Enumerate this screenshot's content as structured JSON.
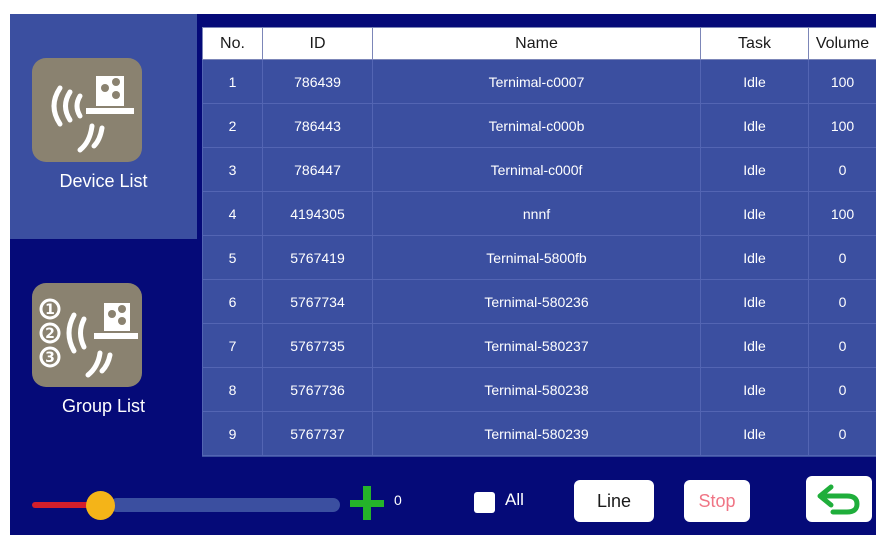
{
  "sidebar": {
    "device_list_label": "Device List",
    "group_list_label": "Group List"
  },
  "table": {
    "headers": [
      "No.",
      "ID",
      "Name",
      "Task",
      "Volume"
    ],
    "rows": [
      [
        "1",
        "786439",
        "Ternimal-c0007",
        "Idle",
        "100"
      ],
      [
        "2",
        "786443",
        "Ternimal-c000b",
        "Idle",
        "100"
      ],
      [
        "3",
        "786447",
        "Ternimal-c000f",
        "Idle",
        "0"
      ],
      [
        "4",
        "4194305",
        "nnnf",
        "Idle",
        "100"
      ],
      [
        "5",
        "5767419",
        "Ternimal-5800fb",
        "Idle",
        "0"
      ],
      [
        "6",
        "5767734",
        "Ternimal-580236",
        "Idle",
        "0"
      ],
      [
        "7",
        "5767735",
        "Ternimal-580237",
        "Idle",
        "0"
      ],
      [
        "8",
        "5767736",
        "Ternimal-580238",
        "Idle",
        "0"
      ],
      [
        "9",
        "5767737",
        "Ternimal-580239",
        "Idle",
        "0"
      ]
    ]
  },
  "controls": {
    "volume_value": "0",
    "all_label": "All",
    "line_label": "Line",
    "stop_label": "Stop",
    "back_icon": "return-arrow-icon"
  },
  "colors": {
    "background": "#050a78",
    "panel": "#3b4fa0",
    "icon_tile": "#8a8270",
    "slider_knob": "#f4b418",
    "minus": "#d41f2b",
    "plus": "#25b42a",
    "stop_text": "#f07585",
    "back_arrow": "#1fae3b"
  }
}
